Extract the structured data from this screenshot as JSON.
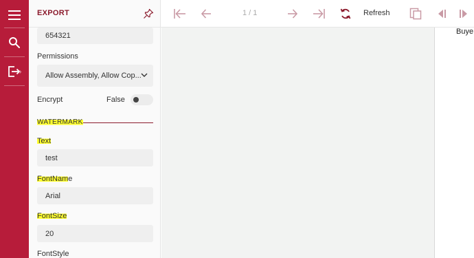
{
  "rail": {
    "items": [
      {
        "name": "menu",
        "icon": "hamburger-menu-icon"
      },
      {
        "name": "search",
        "icon": "search-icon"
      },
      {
        "name": "export",
        "icon": "export-icon"
      }
    ],
    "expand_glyph": "›"
  },
  "panel": {
    "title": "EXPORT",
    "password_value": "654321",
    "permissions_label": "Permissions",
    "permissions_value": "Allow Assembly, Allow Cop...",
    "encrypt_label": "Encrypt",
    "encrypt_value": "False",
    "encrypt_on": false,
    "watermark_section": "WATERMARK",
    "text_label": "Text",
    "text_value": "test",
    "fontname_label_hl": "FontNam",
    "fontname_label_rest": "e",
    "fontname_value": "Arial",
    "fontsize_label": "FontSize",
    "fontsize_value": "20",
    "fontstyle_label": "FontStyle"
  },
  "toolbar": {
    "page_indicator": "1 / 1",
    "refresh_label": "Refresh"
  },
  "document": {
    "visible_text": "Buye"
  },
  "colors": {
    "brand": "#b71c3a",
    "accent": "#8b1a2c",
    "toolbar_icon": "#c99aa5",
    "highlight": "#ffff2d"
  }
}
